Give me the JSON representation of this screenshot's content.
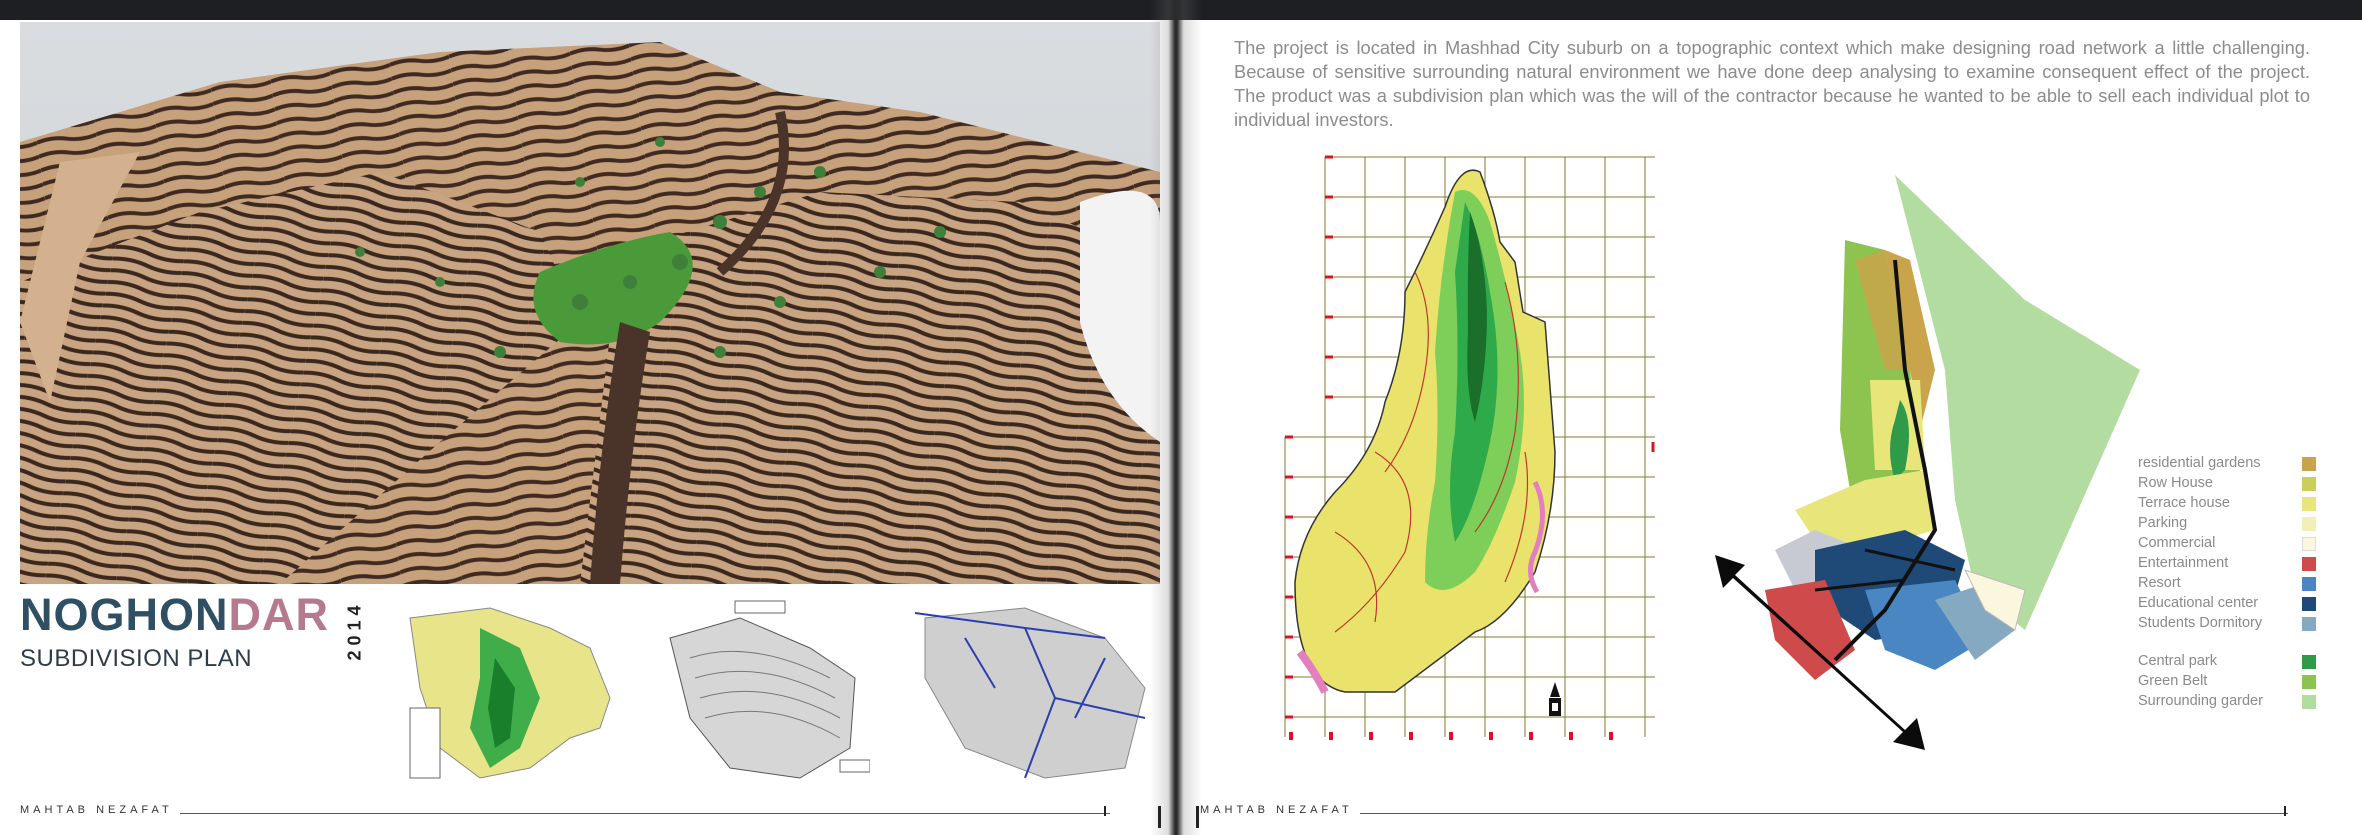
{
  "left_page": {
    "title_part1": "NOGHON",
    "title_part2": "DAR",
    "subtitle": "SUBDIVISION PLAN",
    "year": "2014",
    "author": "MAHTAB NEZAFAT"
  },
  "right_page": {
    "description": "The project is located in Mashhad City suburb on a topographic context which make designing road network a little challenging. Because of sensitive surrounding natural environment we have done deep analysing to examine consequent effect of the project. The product was a subdivision plan which was the will of the contractor because he wanted to be able to sell each individual plot to individual investors.",
    "author": "MAHTAB NEZAFAT",
    "legend": [
      {
        "label": "residential gardens",
        "color": "#c9a44a"
      },
      {
        "label": "Row House",
        "color": "#c8cf5a"
      },
      {
        "label": "Terrace house",
        "color": "#e8e67a"
      },
      {
        "label": "Parking",
        "color": "#f3efb9"
      },
      {
        "label": "Commercial",
        "color": "#fbf7df"
      },
      {
        "label": "Entertainment",
        "color": "#cf4a4a"
      },
      {
        "label": "Resort",
        "color": "#4a86c2"
      },
      {
        "label": "Educational center",
        "color": "#1f4a78"
      },
      {
        "label": "Students Dormitory",
        "color": "#86a9c2"
      },
      {
        "label": "Central park",
        "color": "#2f9a4a"
      },
      {
        "label": "Green Belt",
        "color": "#8dc450"
      },
      {
        "label": "Surrounding garder",
        "color": "#b3dca0"
      }
    ]
  }
}
